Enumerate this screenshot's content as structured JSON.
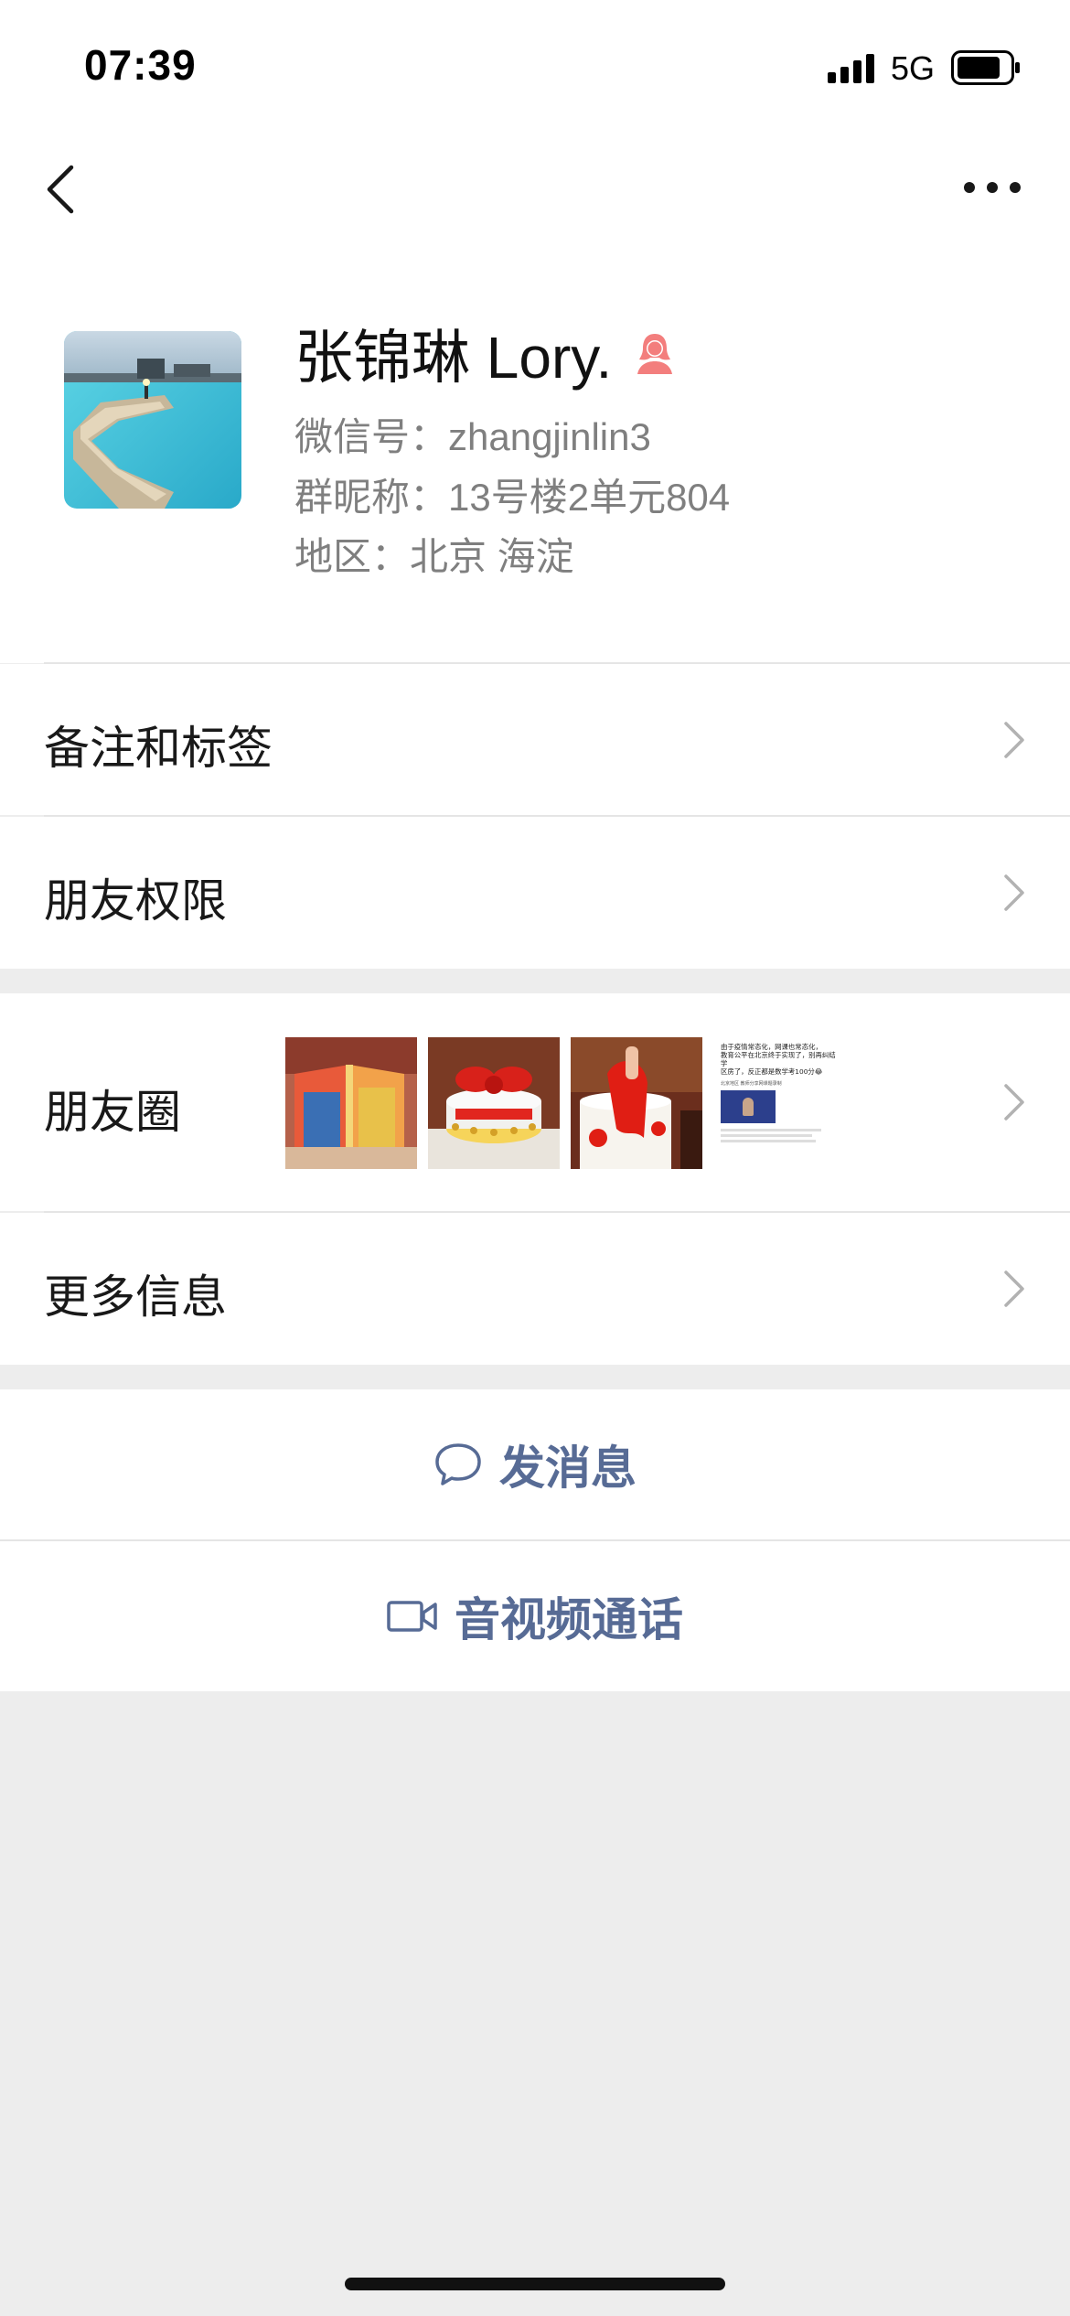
{
  "status_bar": {
    "time": "07:39",
    "network": "5G"
  },
  "profile": {
    "name": "张锦琳 Lory.",
    "wechat_id": "微信号：zhangjinlin3",
    "group_nickname": "群昵称：13号楼2单元804",
    "region": "地区：北京 海淀",
    "gender_color": "#f37e7d"
  },
  "menu": {
    "remarks_label": "备注和标签",
    "permissions_label": "朋友权限",
    "moments_label": "朋友圈",
    "more_info_label": "更多信息"
  },
  "moments_thumbs": [
    "gift-box",
    "cake-red-bow",
    "cake-cutting",
    "article"
  ],
  "thumb_article": {
    "line1": "由于疫情常态化，网课也常态化，",
    "line2": "教育公平在北京终于实现了，别再纠结学",
    "line3": "区房了，反正都是数学考100分😂",
    "caption": "北京地区 教师分享网课题录制"
  },
  "actions": {
    "send_message": "发消息",
    "video_call": "音视频通话"
  },
  "colors": {
    "accent": "#576b95",
    "background": "#ededed"
  }
}
